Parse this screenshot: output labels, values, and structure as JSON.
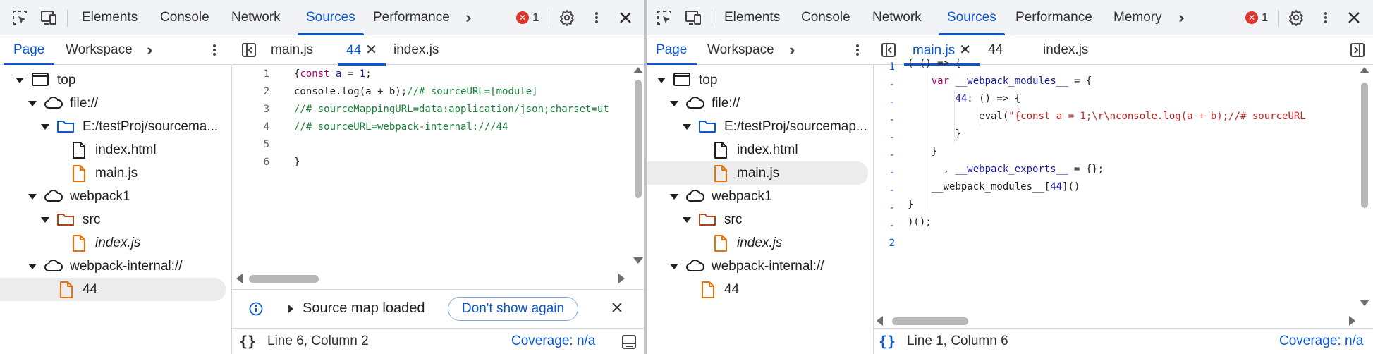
{
  "colors": {
    "accent": "#0b57d0",
    "error": "#dc362e",
    "folder_blue": "#0b57d0",
    "folder_brown": "#b0471a",
    "file_orange": "#e8710a"
  },
  "left": {
    "tabs": [
      "Elements",
      "Console",
      "Network",
      "Sources",
      "Performance"
    ],
    "active_tab": "Sources",
    "error_count": "1",
    "nav_tabs": [
      "Page",
      "Workspace"
    ],
    "tree": [
      "top",
      "file://",
      "E:/testProj/sourcema...",
      "index.html",
      "main.js",
      "webpack1",
      "src",
      "index.js",
      "webpack-internal://",
      "44"
    ],
    "editor_tabs": {
      "t1": "main.js",
      "t2": "44",
      "t3": "index.js"
    },
    "lines": [
      {
        "n": "1",
        "t": "{const a = 1;"
      },
      {
        "n": "2",
        "t": "console.log(a + b);//# sourceURL=[module]"
      },
      {
        "n": "3",
        "t": "//# sourceMappingURL=data:application/json;charset=ut"
      },
      {
        "n": "4",
        "t": "//# sourceURL=webpack-internal:///44"
      },
      {
        "n": "5",
        "t": ""
      },
      {
        "n": "6",
        "t": "}"
      }
    ],
    "infobar": {
      "text": "Source map loaded",
      "button": "Don't show again"
    },
    "status": {
      "position": "Line 6, Column 2",
      "coverage": "Coverage: n/a"
    }
  },
  "right": {
    "tabs": [
      "Elements",
      "Console",
      "Network",
      "Sources",
      "Performance",
      "Memory"
    ],
    "active_tab": "Sources",
    "error_count": "1",
    "nav_tabs": [
      "Page",
      "Workspace"
    ],
    "tree": [
      "top",
      "file://",
      "E:/testProj/sourcemap...",
      "index.html",
      "main.js",
      "webpack1",
      "src",
      "index.js",
      "webpack-internal://",
      "44"
    ],
    "editor_tabs": {
      "t1": "main.js",
      "t2": "44",
      "t3": "index.js"
    },
    "gutter": [
      "1",
      "-",
      "-",
      "-",
      "-",
      "-",
      "-",
      "-",
      "-",
      "-",
      "2"
    ],
    "lines": [
      "( () => {",
      "    var __webpack_modules__ = {",
      "        44: () => {",
      "            eval(\"{const a = 1;\\r\\nconsole.log(a + b);//# sourceURL",
      "        }",
      "    }",
      "      , __webpack_exports__ = {};",
      "    __webpack_modules__[44]()",
      "}",
      ")();",
      ""
    ],
    "status": {
      "position": "Line 1, Column 6",
      "coverage": "Coverage: n/a"
    }
  }
}
